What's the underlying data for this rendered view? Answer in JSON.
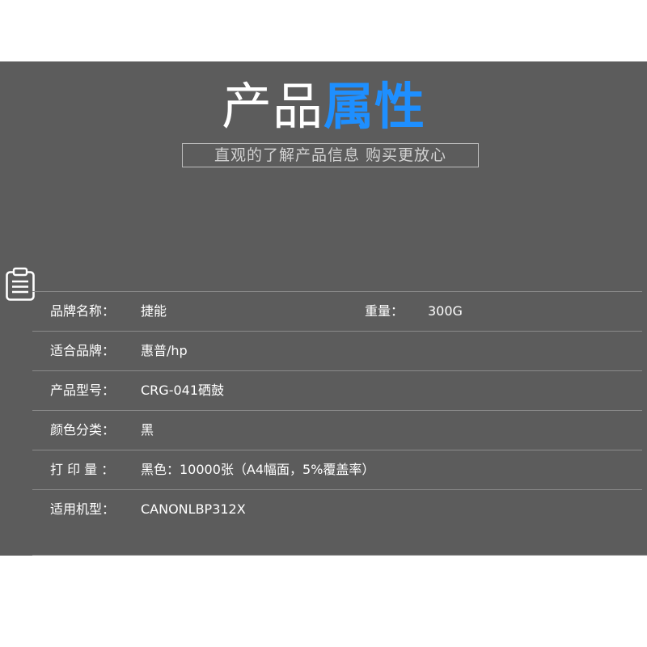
{
  "header": {
    "title_plain": "产品",
    "title_accent": "属性",
    "subtitle": "直观的了解产品信息 购买更放心",
    "accent_color": "#1e8fff",
    "panel_color": "#5c5c5c"
  },
  "icon": "clipboard-icon",
  "attributes": [
    {
      "label": "品牌名称：",
      "value": "捷能",
      "label2": "重量：",
      "value2": "300G"
    },
    {
      "label": "适合品牌：",
      "value": "惠普/hp"
    },
    {
      "label": "产品型号：",
      "value": "CRG-041硒鼓"
    },
    {
      "label": "颜色分类：",
      "value": " 黑"
    },
    {
      "label": "打 印 量 ：",
      "value": "黑色：10000张（A4幅面，5%覆盖率）"
    },
    {
      "label": "适用机型：",
      "value": "CANONLBP312X"
    }
  ]
}
